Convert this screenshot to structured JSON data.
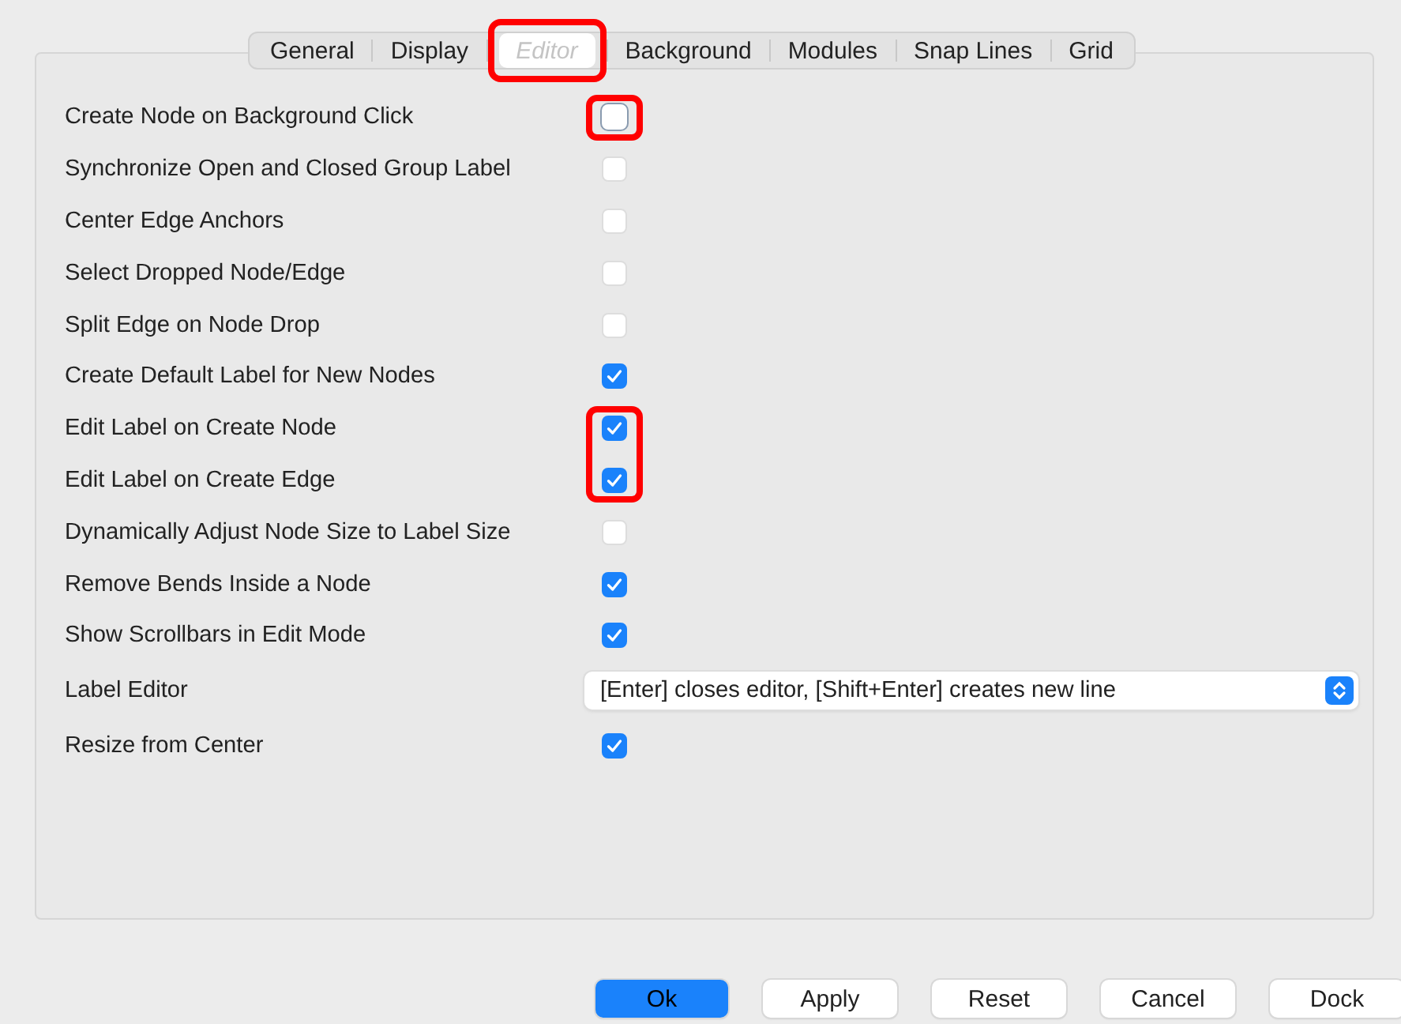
{
  "tabs": [
    {
      "label": "General",
      "selected": false,
      "highlighted": false
    },
    {
      "label": "Display",
      "selected": false,
      "highlighted": false
    },
    {
      "label": "Editor",
      "selected": true,
      "highlighted": true
    },
    {
      "label": "Background",
      "selected": false,
      "highlighted": false
    },
    {
      "label": "Modules",
      "selected": false,
      "highlighted": false
    },
    {
      "label": "Snap Lines",
      "selected": false,
      "highlighted": false
    },
    {
      "label": "Grid",
      "selected": false,
      "highlighted": false
    }
  ],
  "options": [
    {
      "kind": "checkbox",
      "label": "Create Node on Background Click",
      "checked": false,
      "focused": true,
      "highlighted": true
    },
    {
      "kind": "checkbox",
      "label": "Synchronize Open and Closed Group Label",
      "checked": false,
      "focused": false,
      "highlighted": false
    },
    {
      "kind": "checkbox",
      "label": "Center Edge Anchors",
      "checked": false,
      "focused": false,
      "highlighted": false
    },
    {
      "kind": "checkbox",
      "label": "Select Dropped Node/Edge",
      "checked": false,
      "focused": false,
      "highlighted": false
    },
    {
      "kind": "checkbox",
      "label": "Split Edge on Node Drop",
      "checked": false,
      "focused": false,
      "highlighted": false
    },
    {
      "kind": "checkbox",
      "label": "Create Default Label for New Nodes",
      "checked": true,
      "focused": false,
      "highlighted": false
    },
    {
      "kind": "checkbox",
      "label": "Edit Label on Create Node",
      "checked": true,
      "focused": false,
      "highlighted": true
    },
    {
      "kind": "checkbox",
      "label": "Edit Label on Create Edge",
      "checked": true,
      "focused": false,
      "highlighted": true
    },
    {
      "kind": "checkbox",
      "label": "Dynamically Adjust Node Size to Label Size",
      "checked": false,
      "focused": false,
      "highlighted": false
    },
    {
      "kind": "checkbox",
      "label": "Remove Bends Inside a Node",
      "checked": true,
      "focused": false,
      "highlighted": false
    },
    {
      "kind": "checkbox",
      "label": "Show Scrollbars in Edit Mode",
      "checked": true,
      "focused": false,
      "highlighted": false
    },
    {
      "kind": "dropdown",
      "label": "Label Editor",
      "value": "[Enter] closes editor, [Shift+Enter] creates new line",
      "highlighted": false
    },
    {
      "kind": "checkbox",
      "label": "Resize from Center",
      "checked": true,
      "focused": false,
      "highlighted": false
    }
  ],
  "buttons": [
    {
      "label": "Ok",
      "default": true
    },
    {
      "label": "Apply",
      "default": false
    },
    {
      "label": "Reset",
      "default": false
    },
    {
      "label": "Cancel",
      "default": false
    },
    {
      "label": "Dock",
      "default": false
    }
  ]
}
